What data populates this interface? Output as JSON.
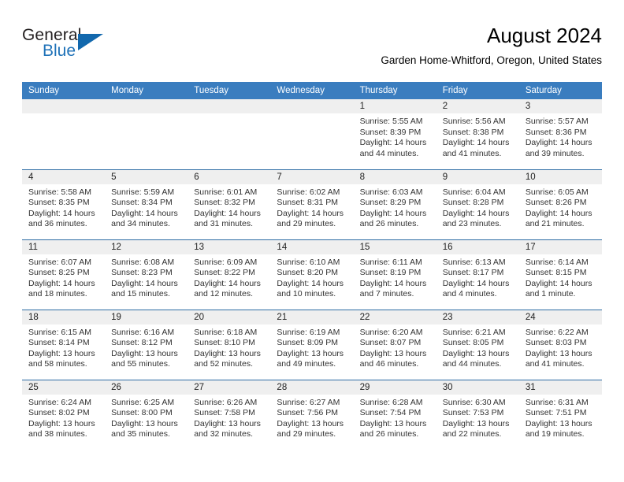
{
  "brand": {
    "name_part1": "General",
    "name_part2": "Blue",
    "logo_icon": "triangle-flag-icon",
    "accent_color": "#1268ad"
  },
  "header": {
    "title": "August 2024",
    "subtitle": "Garden Home-Whitford, Oregon, United States"
  },
  "theme": {
    "header_row_bg": "#3a7dbf",
    "row_divider": "#2e6da4",
    "daynum_band_bg": "#efefef",
    "text": "#333333"
  },
  "calendar": {
    "weekday_headers": [
      "Sunday",
      "Monday",
      "Tuesday",
      "Wednesday",
      "Thursday",
      "Friday",
      "Saturday"
    ],
    "weeks": [
      [
        {
          "day": "",
          "sunrise": "",
          "sunset": "",
          "daylight_line1": "",
          "daylight_line2": ""
        },
        {
          "day": "",
          "sunrise": "",
          "sunset": "",
          "daylight_line1": "",
          "daylight_line2": ""
        },
        {
          "day": "",
          "sunrise": "",
          "sunset": "",
          "daylight_line1": "",
          "daylight_line2": ""
        },
        {
          "day": "",
          "sunrise": "",
          "sunset": "",
          "daylight_line1": "",
          "daylight_line2": ""
        },
        {
          "day": "1",
          "sunrise": "Sunrise: 5:55 AM",
          "sunset": "Sunset: 8:39 PM",
          "daylight_line1": "Daylight: 14 hours",
          "daylight_line2": "and 44 minutes."
        },
        {
          "day": "2",
          "sunrise": "Sunrise: 5:56 AM",
          "sunset": "Sunset: 8:38 PM",
          "daylight_line1": "Daylight: 14 hours",
          "daylight_line2": "and 41 minutes."
        },
        {
          "day": "3",
          "sunrise": "Sunrise: 5:57 AM",
          "sunset": "Sunset: 8:36 PM",
          "daylight_line1": "Daylight: 14 hours",
          "daylight_line2": "and 39 minutes."
        }
      ],
      [
        {
          "day": "4",
          "sunrise": "Sunrise: 5:58 AM",
          "sunset": "Sunset: 8:35 PM",
          "daylight_line1": "Daylight: 14 hours",
          "daylight_line2": "and 36 minutes."
        },
        {
          "day": "5",
          "sunrise": "Sunrise: 5:59 AM",
          "sunset": "Sunset: 8:34 PM",
          "daylight_line1": "Daylight: 14 hours",
          "daylight_line2": "and 34 minutes."
        },
        {
          "day": "6",
          "sunrise": "Sunrise: 6:01 AM",
          "sunset": "Sunset: 8:32 PM",
          "daylight_line1": "Daylight: 14 hours",
          "daylight_line2": "and 31 minutes."
        },
        {
          "day": "7",
          "sunrise": "Sunrise: 6:02 AM",
          "sunset": "Sunset: 8:31 PM",
          "daylight_line1": "Daylight: 14 hours",
          "daylight_line2": "and 29 minutes."
        },
        {
          "day": "8",
          "sunrise": "Sunrise: 6:03 AM",
          "sunset": "Sunset: 8:29 PM",
          "daylight_line1": "Daylight: 14 hours",
          "daylight_line2": "and 26 minutes."
        },
        {
          "day": "9",
          "sunrise": "Sunrise: 6:04 AM",
          "sunset": "Sunset: 8:28 PM",
          "daylight_line1": "Daylight: 14 hours",
          "daylight_line2": "and 23 minutes."
        },
        {
          "day": "10",
          "sunrise": "Sunrise: 6:05 AM",
          "sunset": "Sunset: 8:26 PM",
          "daylight_line1": "Daylight: 14 hours",
          "daylight_line2": "and 21 minutes."
        }
      ],
      [
        {
          "day": "11",
          "sunrise": "Sunrise: 6:07 AM",
          "sunset": "Sunset: 8:25 PM",
          "daylight_line1": "Daylight: 14 hours",
          "daylight_line2": "and 18 minutes."
        },
        {
          "day": "12",
          "sunrise": "Sunrise: 6:08 AM",
          "sunset": "Sunset: 8:23 PM",
          "daylight_line1": "Daylight: 14 hours",
          "daylight_line2": "and 15 minutes."
        },
        {
          "day": "13",
          "sunrise": "Sunrise: 6:09 AM",
          "sunset": "Sunset: 8:22 PM",
          "daylight_line1": "Daylight: 14 hours",
          "daylight_line2": "and 12 minutes."
        },
        {
          "day": "14",
          "sunrise": "Sunrise: 6:10 AM",
          "sunset": "Sunset: 8:20 PM",
          "daylight_line1": "Daylight: 14 hours",
          "daylight_line2": "and 10 minutes."
        },
        {
          "day": "15",
          "sunrise": "Sunrise: 6:11 AM",
          "sunset": "Sunset: 8:19 PM",
          "daylight_line1": "Daylight: 14 hours",
          "daylight_line2": "and 7 minutes."
        },
        {
          "day": "16",
          "sunrise": "Sunrise: 6:13 AM",
          "sunset": "Sunset: 8:17 PM",
          "daylight_line1": "Daylight: 14 hours",
          "daylight_line2": "and 4 minutes."
        },
        {
          "day": "17",
          "sunrise": "Sunrise: 6:14 AM",
          "sunset": "Sunset: 8:15 PM",
          "daylight_line1": "Daylight: 14 hours",
          "daylight_line2": "and 1 minute."
        }
      ],
      [
        {
          "day": "18",
          "sunrise": "Sunrise: 6:15 AM",
          "sunset": "Sunset: 8:14 PM",
          "daylight_line1": "Daylight: 13 hours",
          "daylight_line2": "and 58 minutes."
        },
        {
          "day": "19",
          "sunrise": "Sunrise: 6:16 AM",
          "sunset": "Sunset: 8:12 PM",
          "daylight_line1": "Daylight: 13 hours",
          "daylight_line2": "and 55 minutes."
        },
        {
          "day": "20",
          "sunrise": "Sunrise: 6:18 AM",
          "sunset": "Sunset: 8:10 PM",
          "daylight_line1": "Daylight: 13 hours",
          "daylight_line2": "and 52 minutes."
        },
        {
          "day": "21",
          "sunrise": "Sunrise: 6:19 AM",
          "sunset": "Sunset: 8:09 PM",
          "daylight_line1": "Daylight: 13 hours",
          "daylight_line2": "and 49 minutes."
        },
        {
          "day": "22",
          "sunrise": "Sunrise: 6:20 AM",
          "sunset": "Sunset: 8:07 PM",
          "daylight_line1": "Daylight: 13 hours",
          "daylight_line2": "and 46 minutes."
        },
        {
          "day": "23",
          "sunrise": "Sunrise: 6:21 AM",
          "sunset": "Sunset: 8:05 PM",
          "daylight_line1": "Daylight: 13 hours",
          "daylight_line2": "and 44 minutes."
        },
        {
          "day": "24",
          "sunrise": "Sunrise: 6:22 AM",
          "sunset": "Sunset: 8:03 PM",
          "daylight_line1": "Daylight: 13 hours",
          "daylight_line2": "and 41 minutes."
        }
      ],
      [
        {
          "day": "25",
          "sunrise": "Sunrise: 6:24 AM",
          "sunset": "Sunset: 8:02 PM",
          "daylight_line1": "Daylight: 13 hours",
          "daylight_line2": "and 38 minutes."
        },
        {
          "day": "26",
          "sunrise": "Sunrise: 6:25 AM",
          "sunset": "Sunset: 8:00 PM",
          "daylight_line1": "Daylight: 13 hours",
          "daylight_line2": "and 35 minutes."
        },
        {
          "day": "27",
          "sunrise": "Sunrise: 6:26 AM",
          "sunset": "Sunset: 7:58 PM",
          "daylight_line1": "Daylight: 13 hours",
          "daylight_line2": "and 32 minutes."
        },
        {
          "day": "28",
          "sunrise": "Sunrise: 6:27 AM",
          "sunset": "Sunset: 7:56 PM",
          "daylight_line1": "Daylight: 13 hours",
          "daylight_line2": "and 29 minutes."
        },
        {
          "day": "29",
          "sunrise": "Sunrise: 6:28 AM",
          "sunset": "Sunset: 7:54 PM",
          "daylight_line1": "Daylight: 13 hours",
          "daylight_line2": "and 26 minutes."
        },
        {
          "day": "30",
          "sunrise": "Sunrise: 6:30 AM",
          "sunset": "Sunset: 7:53 PM",
          "daylight_line1": "Daylight: 13 hours",
          "daylight_line2": "and 22 minutes."
        },
        {
          "day": "31",
          "sunrise": "Sunrise: 6:31 AM",
          "sunset": "Sunset: 7:51 PM",
          "daylight_line1": "Daylight: 13 hours",
          "daylight_line2": "and 19 minutes."
        }
      ]
    ]
  }
}
